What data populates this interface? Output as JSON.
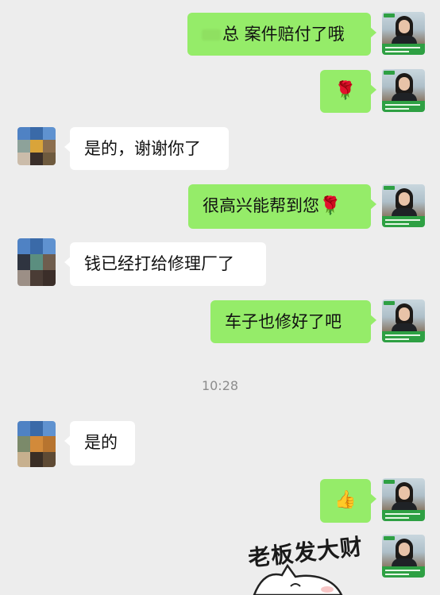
{
  "messages": [
    {
      "id": "m1",
      "dir": "out",
      "text": "总 案件赔付了哦"
    },
    {
      "id": "m2",
      "dir": "out",
      "emoji": "🌹"
    },
    {
      "id": "m3",
      "dir": "in",
      "text": "是的，谢谢你了"
    },
    {
      "id": "m4",
      "dir": "out",
      "text": "很高兴能帮到您",
      "emoji": "🌹"
    },
    {
      "id": "m5",
      "dir": "in",
      "text": "钱已经打给修理厂了"
    },
    {
      "id": "m6",
      "dir": "out",
      "text": "车子也修好了吧"
    },
    {
      "id": "m7",
      "dir": "in",
      "text": "是的"
    },
    {
      "id": "m8",
      "dir": "out",
      "emoji": "👍"
    }
  ],
  "timestamp": "10:28",
  "sticker": {
    "text": "老板发大财"
  },
  "colors": {
    "background": "#ededed",
    "outgoing_bubble": "#95ec69",
    "incoming_bubble": "#ffffff",
    "timestamp_text": "#8c8c8c"
  },
  "icons": {
    "agent_avatar": "agent-avatar-icon",
    "user_avatar": "user-avatar-icon",
    "rose": "rose-emoji",
    "thumbs_up": "thumbs-up-emoji"
  }
}
